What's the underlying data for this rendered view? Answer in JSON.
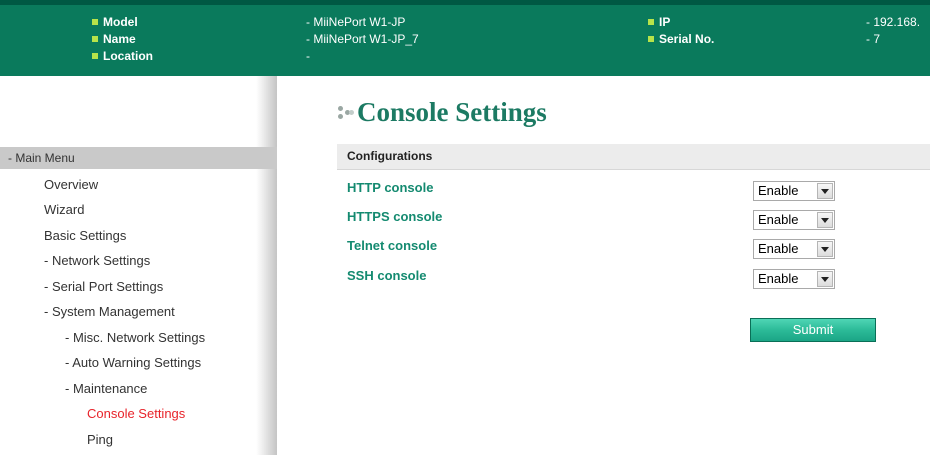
{
  "header": {
    "model_label": "Model",
    "model_value": "- MiiNePort W1-JP",
    "name_label": "Name",
    "name_value": "- MiiNePort W1-JP_7",
    "location_label": "Location",
    "location_value": "-",
    "ip_label": "IP",
    "ip_value": "- 192.168.",
    "serial_label": "Serial No.",
    "serial_value": "- 7"
  },
  "sidebar": {
    "menu_title": "- Main Menu",
    "items": [
      {
        "label": "Overview"
      },
      {
        "label": "Wizard"
      },
      {
        "label": "Basic Settings"
      },
      {
        "label": "- Network Settings"
      },
      {
        "label": "- Serial Port Settings"
      },
      {
        "label": "- System Management"
      },
      {
        "label": "- Misc. Network Settings"
      },
      {
        "label": "- Auto Warning Settings"
      },
      {
        "label": "- Maintenance"
      },
      {
        "label": "Console Settings",
        "active": true
      },
      {
        "label": "Ping"
      }
    ]
  },
  "main": {
    "title": "Console Settings",
    "section": "Configurations",
    "rows": [
      {
        "label": "HTTP console",
        "value": "Enable"
      },
      {
        "label": "HTTPS console",
        "value": "Enable"
      },
      {
        "label": "Telnet console",
        "value": "Enable"
      },
      {
        "label": "SSH console",
        "value": "Enable"
      }
    ],
    "submit_label": "Submit"
  },
  "colors": {
    "header_bg": "#0a7a5c",
    "bullet": "#b7e34a",
    "title": "#1c7a63",
    "field_label": "#148a70",
    "active_menu": "#e8242b",
    "submit_bg": "#2cbb98"
  }
}
